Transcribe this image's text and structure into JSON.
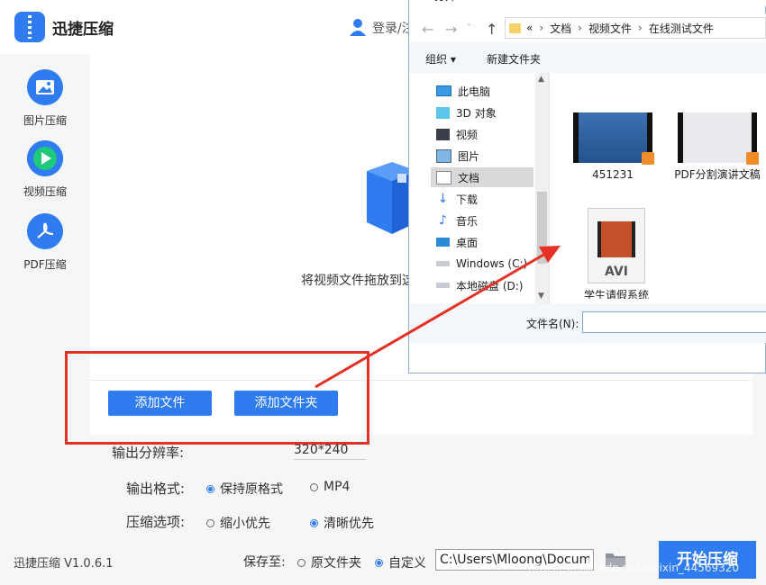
{
  "app": {
    "title": "迅捷压缩",
    "login": "登录/注",
    "version": "迅捷压缩 V1.0.6.1"
  },
  "sidebar": {
    "items": [
      {
        "label": "图片压缩",
        "icon": "image-icon"
      },
      {
        "label": "视频压缩",
        "icon": "play-icon"
      },
      {
        "label": "PDF压缩",
        "icon": "pdf-icon"
      }
    ]
  },
  "main": {
    "drop_text": "将视频文件拖放到这",
    "add_file": "添加文件",
    "add_folder": "添加文件夹"
  },
  "settings": {
    "resolution_label": "输出分辨率:",
    "resolution_value": "320*240",
    "format_label": "输出格式:",
    "format_options": [
      "保持原格式",
      "MP4"
    ],
    "format_selected": "保持原格式",
    "compress_label": "压缩选项:",
    "compress_options": [
      "缩小优先",
      "清晰优先"
    ],
    "compress_selected": "清晰优先"
  },
  "bottom": {
    "save_to": "保存至:",
    "save_options": [
      "原文件夹",
      "自定义"
    ],
    "save_selected": "自定义",
    "path": "C:\\Users\\Mloong\\Docume",
    "start": "开始压缩",
    "watermark": "https://blog.csdn.net/weixin_44569320"
  },
  "dialog": {
    "title": "打开",
    "breadcrumb": [
      "«",
      "文档",
      "视频文件",
      "在线测试文件"
    ],
    "toolbar": {
      "organize": "组织 ▾",
      "new_folder": "新建文件夹"
    },
    "tree": [
      {
        "label": "此电脑",
        "icon": "computer-icon"
      },
      {
        "label": "3D 对象",
        "icon": "cube-icon"
      },
      {
        "label": "视频",
        "icon": "film-icon"
      },
      {
        "label": "图片",
        "icon": "picture-icon"
      },
      {
        "label": "文档",
        "icon": "document-icon"
      },
      {
        "label": "下载",
        "icon": "download-icon"
      },
      {
        "label": "音乐",
        "icon": "music-icon"
      },
      {
        "label": "桌面",
        "icon": "desktop-icon"
      },
      {
        "label": "Windows (C:)",
        "icon": "drive-icon"
      },
      {
        "label": "本地磁盘 (D:)",
        "icon": "drive-icon"
      }
    ],
    "tree_selected": "文档",
    "files": [
      {
        "name": "451231"
      },
      {
        "name": "PDF分割演讲文稿"
      },
      {
        "name": "学生请假系统",
        "badge": "AVI"
      }
    ],
    "filename_label": "文件名(N):"
  },
  "colors": {
    "accent": "#2f7bf0",
    "annotation": "#e53125"
  }
}
